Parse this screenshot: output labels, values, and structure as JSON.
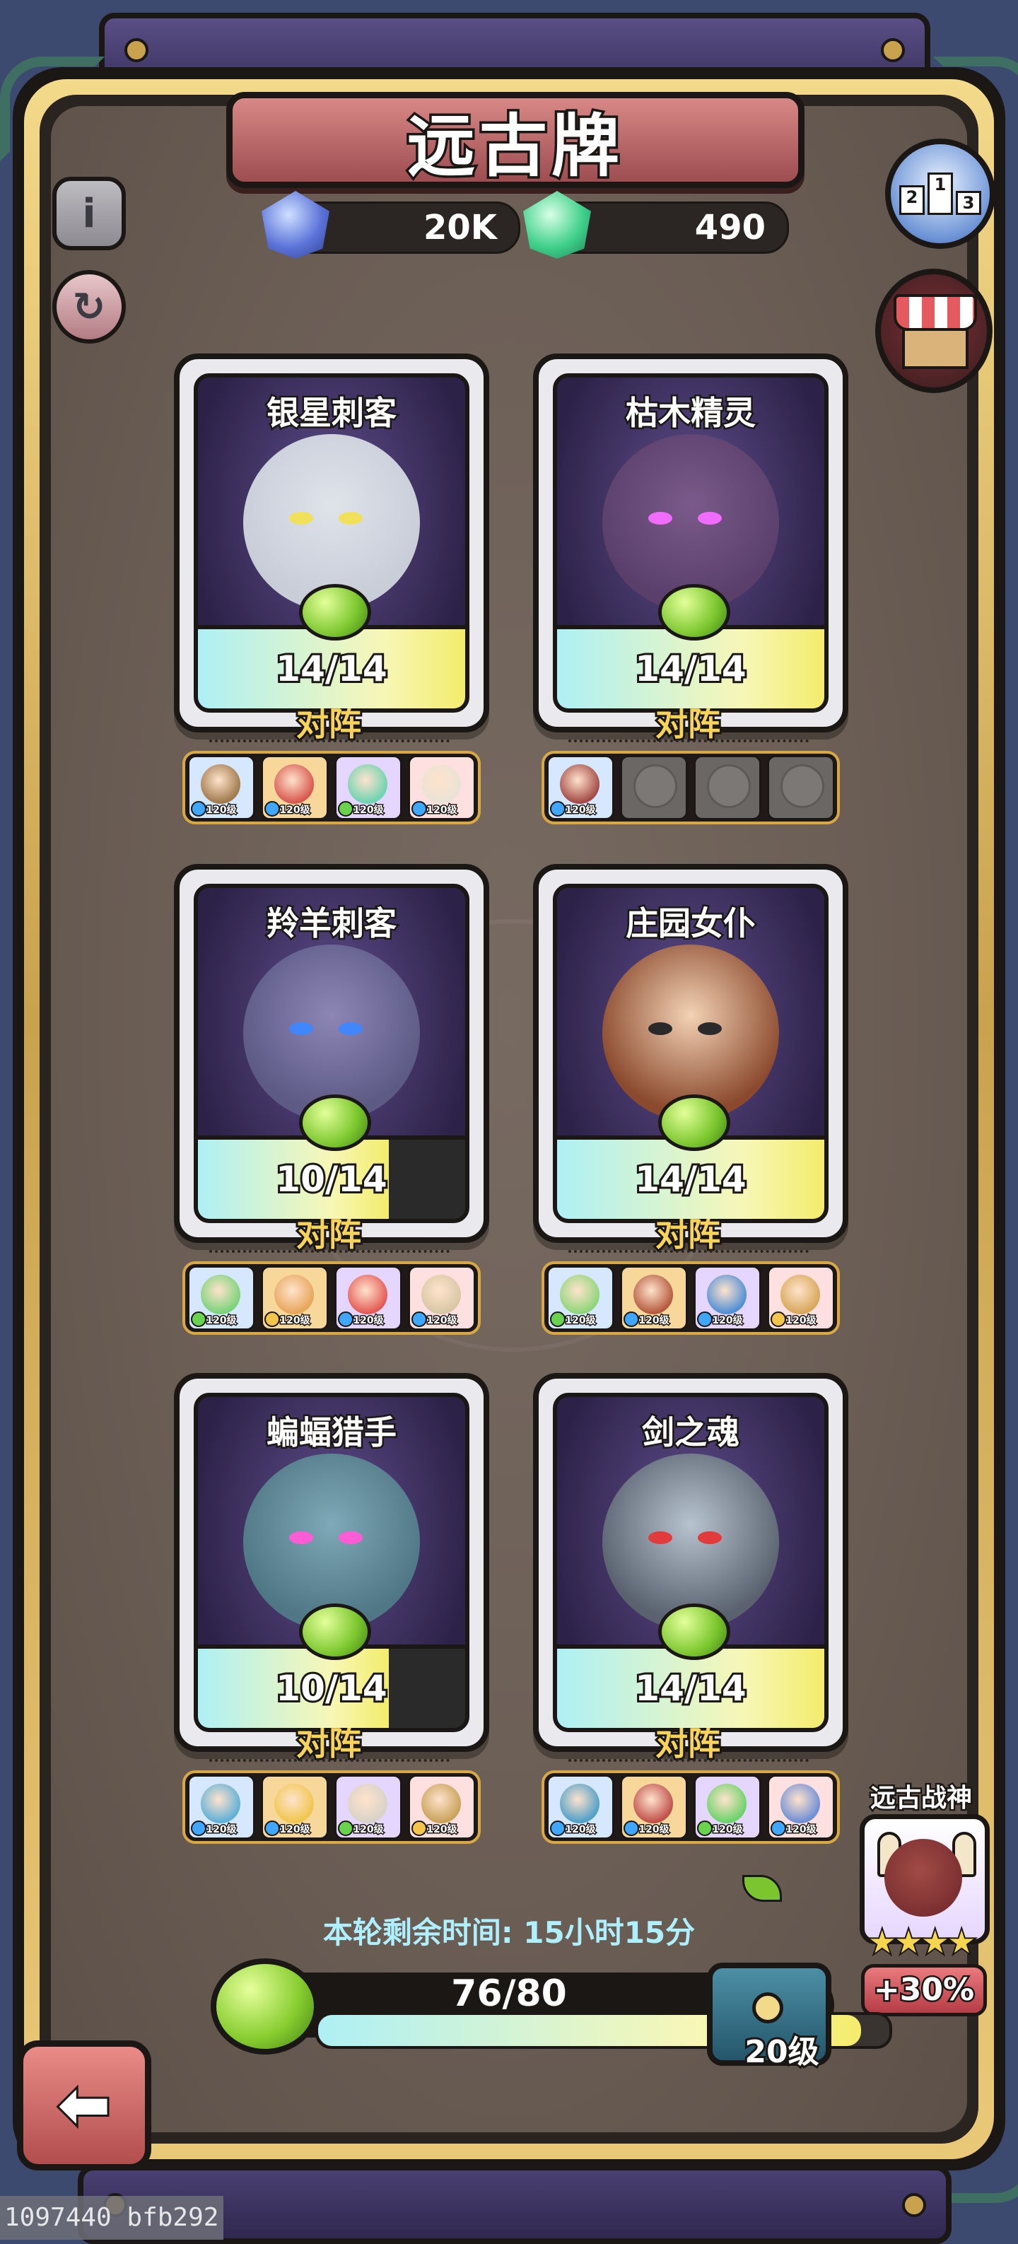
{
  "title": "远古牌",
  "currency": {
    "blue_gem": "20K",
    "green_gem": "490"
  },
  "buttons": {
    "info_icon": "i",
    "back_icon": "⬅"
  },
  "rank_podium": [
    "2",
    "1",
    "3"
  ],
  "vs_label": "对阵",
  "hero_level": "120级",
  "cards": [
    {
      "name": "银星刺客",
      "progress_text": "14/14",
      "progress": 1.0
    },
    {
      "name": "枯木精灵",
      "progress_text": "14/14",
      "progress": 1.0
    },
    {
      "name": "羚羊刺客",
      "progress_text": "10/14",
      "progress": 0.714
    },
    {
      "name": "庄园女仆",
      "progress_text": "14/14",
      "progress": 1.0
    },
    {
      "name": "蝙蝠猎手",
      "progress_text": "10/14",
      "progress": 0.714
    },
    {
      "name": "剑之魂",
      "progress_text": "14/14",
      "progress": 1.0
    }
  ],
  "timer": {
    "label": "本轮剩余时间:",
    "value": "15小时15分"
  },
  "round_progress": {
    "text": "76/80",
    "value": 0.95
  },
  "reward_level": "20级",
  "boss": {
    "title": "远古战神",
    "stars": "★★★★",
    "star_count": 4,
    "buff": "+30%"
  },
  "watermark": "1097440 bfb292",
  "colors": {
    "board": "#6b5e55",
    "frame_gold": "#e3c070",
    "accent_red": "#b24e4e",
    "vs_text": "#f7d35a",
    "timer_text": "#aef0ff"
  }
}
